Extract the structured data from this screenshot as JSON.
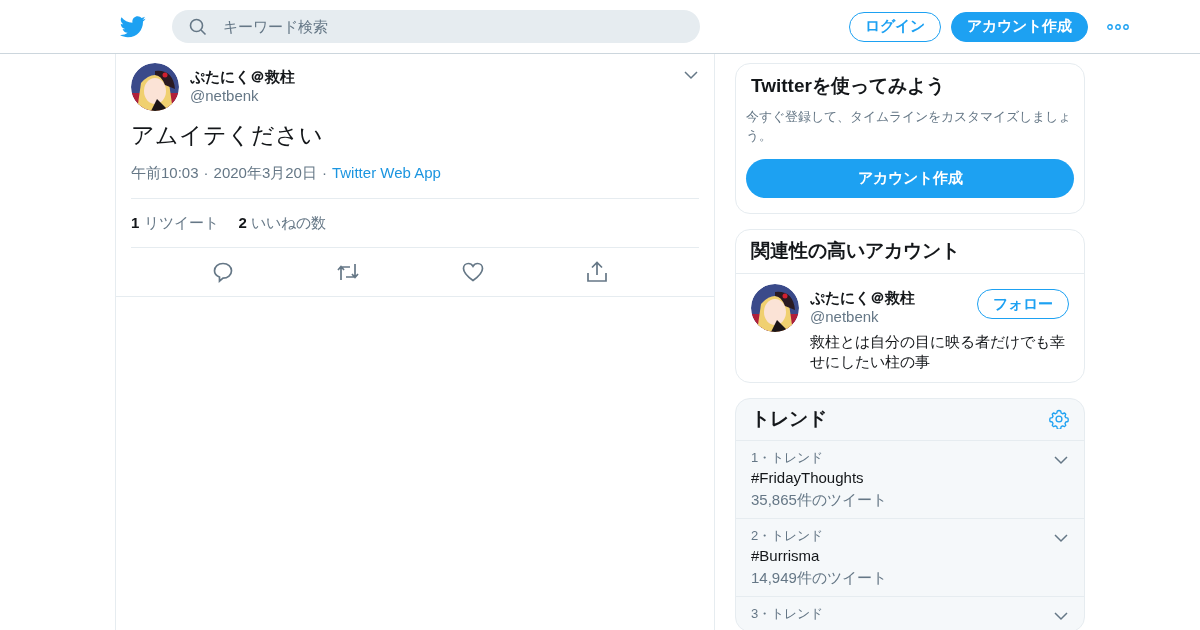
{
  "header": {
    "search": {
      "placeholder": "キーワード検索"
    },
    "login": "ログイン",
    "signup": "アカウント作成"
  },
  "tweet": {
    "name": "ぷたにく＠救柱",
    "handle": "@netbenk",
    "text": "アムイテください",
    "time": "午前10:03",
    "date": "2020年3月20日",
    "source": "Twitter Web App",
    "separator": "·",
    "stats": [
      {
        "count": "1",
        "label": "リツイート"
      },
      {
        "count": "2",
        "label": "いいねの数"
      }
    ]
  },
  "signup_card": {
    "title": "Twitterを使ってみよう",
    "text": "今すぐ登録して、タイムラインをカスタマイズしましょう。",
    "button": "アカウント作成"
  },
  "related": {
    "title": "関連性の高いアカウント",
    "accounts": [
      {
        "name": "ぷたにく＠救柱",
        "handle": "@netbenk",
        "bio": "救柱とは自分の目に映る者だけでも幸せにしたい柱の事",
        "button": "フォロー"
      }
    ]
  },
  "trends": {
    "title": "トレンド",
    "items": [
      {
        "rank": "1・トレンド",
        "tag": "#FridayThoughts",
        "count": "35,865件のツイート"
      },
      {
        "rank": "2・トレンド",
        "tag": "#Burrisma",
        "count": "14,949件のツイート"
      },
      {
        "rank": "3・トレンド"
      }
    ]
  }
}
